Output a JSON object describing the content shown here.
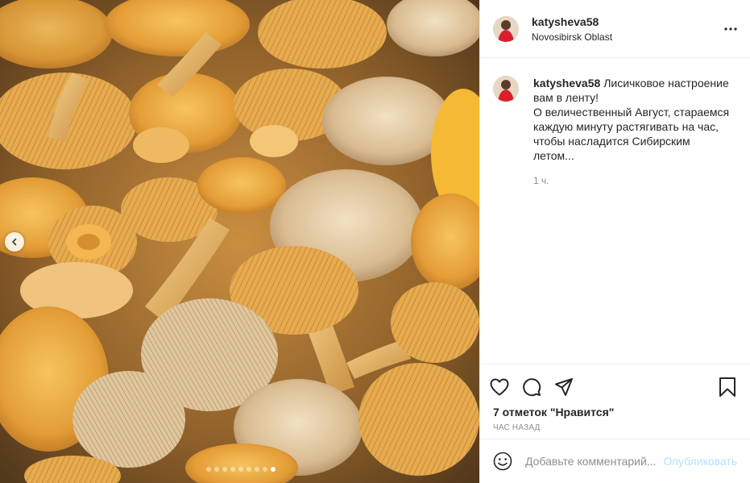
{
  "post": {
    "username": "katysheva58",
    "location": "Novosibirsk Oblast",
    "caption": {
      "username": "katysheva58",
      "lines": [
        "Лисичковое настроение",
        "вам в ленту!",
        "О величественный Август, стараемся",
        "каждую минуту растягивать на час,",
        "чтобы насладится Сибирским",
        "летом..."
      ],
      "time": "1 ч."
    },
    "likes_text": "7 отметок \"Нравится\"",
    "time_ago": "ЧАС НАЗАД",
    "comment_placeholder": "Добавьте комментарий...",
    "publish_label": "Опубликовать",
    "carousel": {
      "count": 9,
      "active_index": 8
    }
  },
  "icons": {
    "more": "more-horizontal-icon",
    "like": "heart-icon",
    "comment": "comment-bubble-icon",
    "share": "paper-plane-icon",
    "save": "bookmark-icon",
    "emoji": "emoji-smile-icon",
    "prev": "chevron-left-icon"
  },
  "colors": {
    "publish_disabled": "#b2dffc",
    "secondary_text": "#8e8e8e",
    "primary_text": "#262626",
    "border": "#efefef"
  }
}
